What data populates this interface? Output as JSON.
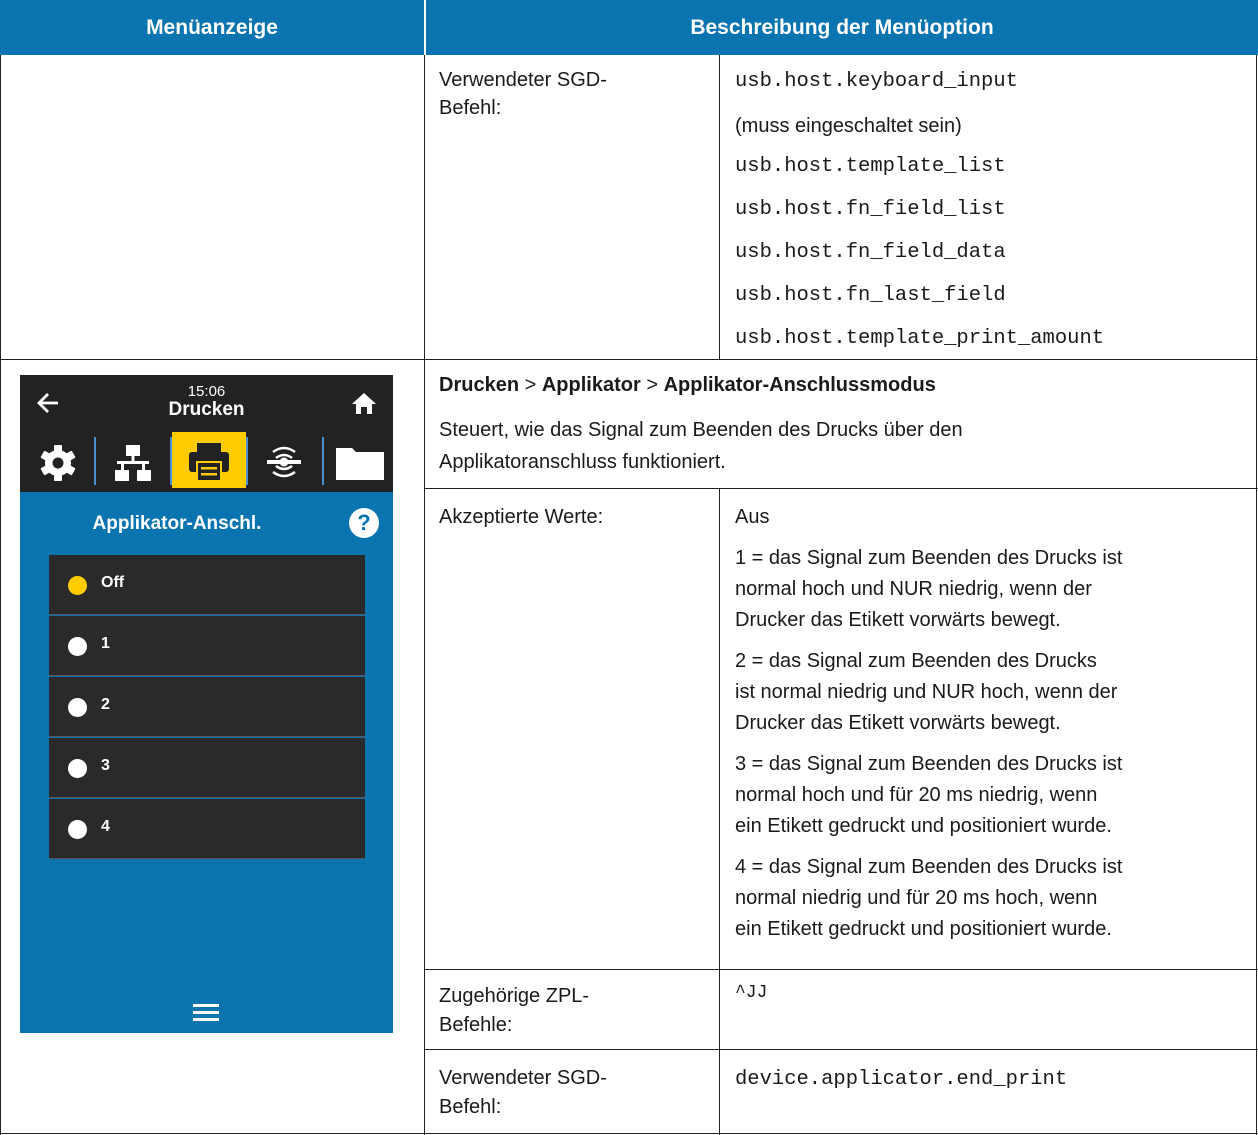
{
  "header": {
    "col_left": "Menüanzeige",
    "col_right": "Beschreibung der Menüoption"
  },
  "row1": {
    "sgd_label_l1": "Verwendeter SGD-",
    "sgd_label_l2": "Befehl:",
    "values": [
      "usb.host.keyboard_input",
      "(muss eingeschaltet sein)",
      "usb.host.template_list",
      "usb.host.fn_field_list",
      "usb.host.fn_field_data",
      "usb.host.fn_last_field",
      "usb.host.template_print_amount"
    ]
  },
  "row2": {
    "path": {
      "p1": "Drucken",
      "sep1": ">",
      "p2": "Applikator",
      "sep2": ">",
      "p3": "Applikator-Anschlussmodus"
    },
    "desc_l1": "Steuert, wie das Signal zum Beenden des Drucks über den",
    "desc_l2": "Applikatoranschluss funktioniert.",
    "accepted_label": "Akzeptierte Werte:",
    "accepted": {
      "v0": "Aus",
      "v1": [
        "1 = das Signal zum Beenden des Drucks ist",
        "normal hoch und NUR niedrig, wenn der",
        "Drucker das Etikett vorwärts bewegt."
      ],
      "v2": [
        "2 = das Signal zum Beenden des Drucks",
        "ist normal niedrig und NUR hoch, wenn der",
        "Drucker das Etikett vorwärts bewegt."
      ],
      "v3": [
        "3 = das Signal zum Beenden des Drucks ist",
        "normal hoch und für 20 ms niedrig, wenn",
        "ein Etikett gedruckt und positioniert wurde."
      ],
      "v4": [
        "4 = das Signal zum Beenden des Drucks ist",
        "normal niedrig und für 20 ms hoch, wenn",
        "ein Etikett gedruckt und positioniert wurde."
      ]
    },
    "zpl_label_l1": "Zugehörige ZPL-",
    "zpl_label_l2": "Befehle:",
    "zpl_value": "^JJ",
    "sgd_label_l1": "Verwendeter SGD-",
    "sgd_label_l2": "Befehl:",
    "sgd_value": "device.applicator.end_print"
  },
  "screen": {
    "time": "15:06",
    "title": "Drucken",
    "menu_title": "Applikator-Anschl.",
    "help": "?",
    "options": [
      "Off",
      "1",
      "2",
      "3",
      "4"
    ],
    "selected_option": "Off",
    "colors": {
      "blue": "#0a74b0",
      "dark": "#222222",
      "accent": "#ffcc00"
    },
    "icons": [
      "back-arrow-icon",
      "home-icon",
      "gear-icon",
      "network-icon",
      "printer-icon",
      "wireless-icon",
      "folder-icon",
      "hamburger-menu-icon",
      "help-icon"
    ]
  }
}
